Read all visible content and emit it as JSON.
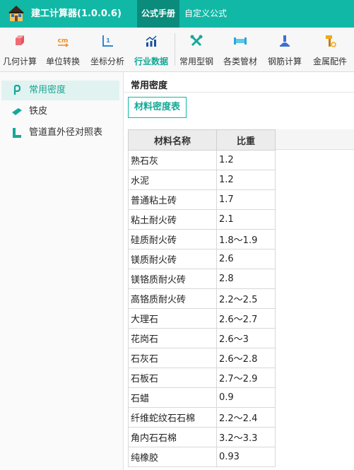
{
  "app": {
    "title": "建工计算器(1.0.0.6)"
  },
  "top_tabs": [
    {
      "label": "公式手册",
      "active": true
    },
    {
      "label": "自定义公式",
      "active": false
    }
  ],
  "toolbar": {
    "items": [
      {
        "label": "几何计算",
        "icon": "cube-icon"
      },
      {
        "label": "单位转换",
        "icon": "unit-convert-icon"
      },
      {
        "label": "坐标分析",
        "icon": "coordinate-icon"
      },
      {
        "label": "行业数据",
        "icon": "bar-chart-icon",
        "active": true
      },
      {
        "label": "常用型钢",
        "icon": "tools-icon"
      },
      {
        "label": "各类管材",
        "icon": "pipe-icon"
      },
      {
        "label": "钢筋计算",
        "icon": "rebar-icon"
      },
      {
        "label": "金属配件",
        "icon": "hammer-icon"
      }
    ]
  },
  "sidebar": {
    "items": [
      {
        "label": "常用密度",
        "icon": "density-icon",
        "active": true
      },
      {
        "label": "铁皮",
        "icon": "sheet-metal-icon"
      },
      {
        "label": "管道直外径对照表",
        "icon": "pipe-table-icon"
      }
    ]
  },
  "main": {
    "section_title": "常用密度",
    "sub_tab": "材料密度表",
    "columns": [
      "材料名称",
      "比重"
    ],
    "rows": [
      [
        "熟石灰",
        "1.2"
      ],
      [
        "水泥",
        "1.2"
      ],
      [
        "普通粘土砖",
        "1.7"
      ],
      [
        "粘土耐火砖",
        "2.1"
      ],
      [
        "硅质耐火砖",
        "1.8～1.9"
      ],
      [
        "镁质耐火砖",
        "2.6"
      ],
      [
        "镁铬质耐火砖",
        "2.8"
      ],
      [
        "高铬质耐火砖",
        "2.2～2.5"
      ],
      [
        "大理石",
        "2.6～2.7"
      ],
      [
        "花岗石",
        "2.6～3"
      ],
      [
        "石灰石",
        "2.6～2.8"
      ],
      [
        "石板石",
        "2.7～2.9"
      ],
      [
        "石蜡",
        "0.9"
      ],
      [
        "纤维蛇纹石石棉",
        "2.2～2.4"
      ],
      [
        "角内石石棉",
        "3.2～3.3"
      ],
      [
        "纯橡胶",
        "0.93"
      ]
    ]
  },
  "colors": {
    "brand": "#12b8a6",
    "active_tab": "#0a8b7c",
    "accent_text": "#1aa392"
  }
}
